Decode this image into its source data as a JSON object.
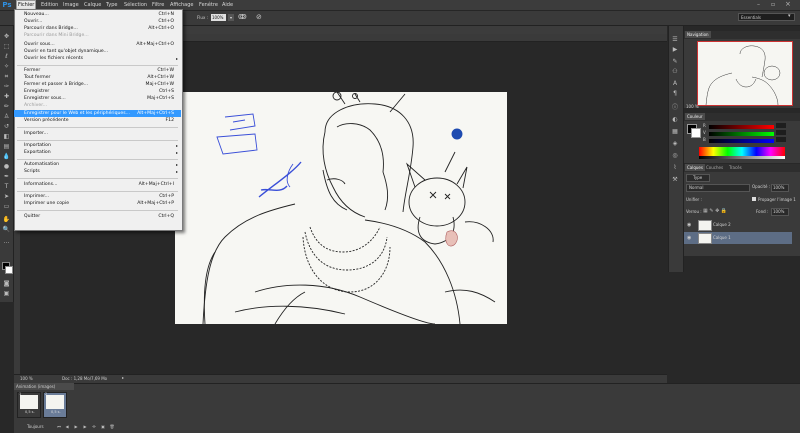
{
  "app": {
    "logo": "Ps"
  },
  "menubar": {
    "items": [
      "Fichier",
      "Edition",
      "Image",
      "Calque",
      "Type",
      "Sélection",
      "Filtre",
      "Affichage",
      "Fenêtre",
      "Aide"
    ]
  },
  "options": {
    "flux_label": "Flux :",
    "flux_value": "100%",
    "workspace": "Essentials"
  },
  "file_menu": {
    "items": [
      {
        "label": "Nouveau...",
        "shortcut": "Ctrl+N"
      },
      {
        "label": "Ouvrir...",
        "shortcut": "Ctrl+O"
      },
      {
        "label": "Parcourir dans Bridge...",
        "shortcut": "Alt+Ctrl+O"
      },
      {
        "label": "Parcourir dans Mini Bridge...",
        "shortcut": "",
        "disabled": true
      },
      {
        "label": "Ouvrir sous...",
        "shortcut": "Alt+Maj+Ctrl+O"
      },
      {
        "label": "Ouvrir en tant qu'objet dynamique...",
        "shortcut": ""
      },
      {
        "label": "Ouvrir les fichiers récents",
        "shortcut": "",
        "submenu": true
      },
      {
        "label": "Fermer",
        "shortcut": "Ctrl+W"
      },
      {
        "label": "Tout fermer",
        "shortcut": "Alt+Ctrl+W"
      },
      {
        "label": "Fermer et passer à Bridge...",
        "shortcut": "Maj+Ctrl+W"
      },
      {
        "label": "Enregistrer",
        "shortcut": "Ctrl+S"
      },
      {
        "label": "Enregistrer sous...",
        "shortcut": "Maj+Ctrl+S"
      },
      {
        "label": "Archiver...",
        "shortcut": "",
        "disabled": true
      },
      {
        "label": "Enregistrer pour le Web et les périphériques...",
        "shortcut": "Alt+Maj+Ctrl+S",
        "highlighted": true
      },
      {
        "label": "Version précédente",
        "shortcut": "F12"
      },
      {
        "label": "Importer...",
        "shortcut": ""
      },
      {
        "label": "Importation",
        "shortcut": "",
        "submenu": true
      },
      {
        "label": "Exportation",
        "shortcut": "",
        "submenu": true
      },
      {
        "label": "Automatisation",
        "shortcut": "",
        "submenu": true
      },
      {
        "label": "Scripts",
        "shortcut": "",
        "submenu": true
      },
      {
        "label": "Informations...",
        "shortcut": "Alt+Maj+Ctrl+I"
      },
      {
        "label": "Imprimer...",
        "shortcut": "Ctrl+P"
      },
      {
        "label": "Imprimer une copie",
        "shortcut": "Alt+Maj+Ctrl+P"
      },
      {
        "label": "Quitter",
        "shortcut": "Ctrl+Q"
      }
    ]
  },
  "status": {
    "zoom": "100 %",
    "doc": "Doc : 1,28 Mo/7,69 Mo"
  },
  "navigator": {
    "tabs": [
      "Navigation"
    ],
    "zoom": "100 %"
  },
  "color": {
    "tabs": [
      "Couleur"
    ],
    "channels": [
      "R",
      "V",
      "B"
    ]
  },
  "layers": {
    "tabs": [
      "Calques",
      "Couches",
      "Tracés"
    ],
    "kind": "Type",
    "blend": "Normal",
    "opacity_label": "Opacité :",
    "opacity_value": "100%",
    "unify_label": "Unifier :",
    "propagate": "Propager l'image 1",
    "lock_label": "Verrou :",
    "fill_label": "Fond :",
    "fill_value": "100%",
    "items": [
      {
        "name": "Calque 2",
        "visible": true,
        "selected": false
      },
      {
        "name": "Calque 1",
        "visible": true,
        "selected": true
      }
    ]
  },
  "animation": {
    "title": "Animation (images)",
    "frames": [
      {
        "number": "1",
        "delay": "0,5 s.",
        "selected": false
      },
      {
        "number": "2",
        "delay": "0,5 s.",
        "selected": true
      }
    ],
    "loop": "Toujours"
  }
}
